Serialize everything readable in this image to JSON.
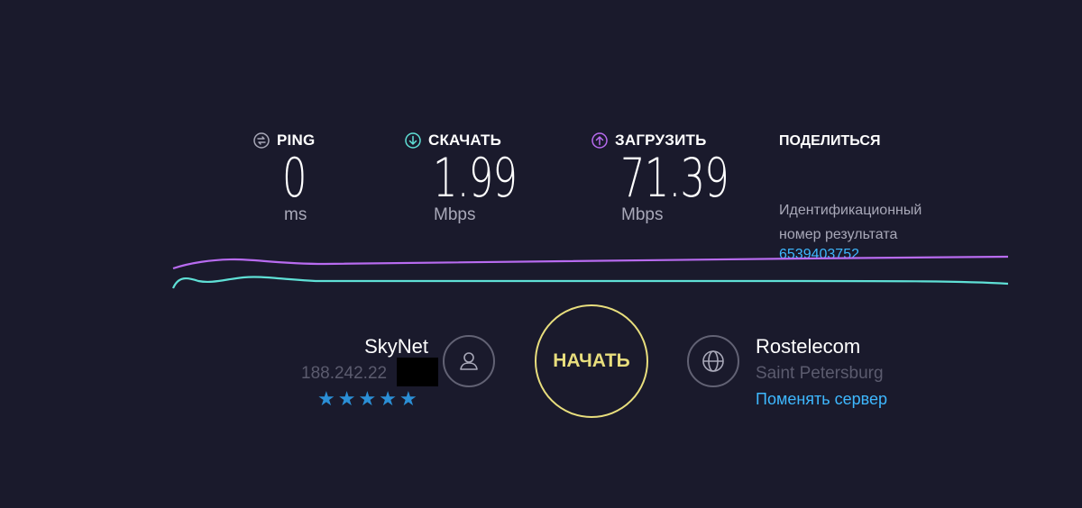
{
  "metrics": {
    "ping": {
      "label": "PING",
      "value": "0",
      "unit": "ms",
      "icon": "ping-icon",
      "color": "#a8a8b8"
    },
    "download": {
      "label": "СКАЧАТЬ",
      "value": "1.99",
      "unit": "Mbps",
      "icon": "download-arrow-icon",
      "color": "#5fe0d6"
    },
    "upload": {
      "label": "ЗАГРУЗИТЬ",
      "value": "71.39",
      "unit": "Mbps",
      "icon": "upload-arrow-icon",
      "color": "#b86bf0"
    }
  },
  "share": {
    "title": "ПОДЕЛИТЬСЯ",
    "result_id_label": "Идентификационный номер результата",
    "result_id": "6539403752"
  },
  "graph": {
    "download_color": "#5fe0d6",
    "upload_color": "#b86bf0"
  },
  "isp": {
    "name": "SkyNet",
    "ip": "188.242.22",
    "rating_stars": 5,
    "stars": [
      "★",
      "★",
      "★",
      "★",
      "★"
    ],
    "icon": "user-icon"
  },
  "start_button": {
    "label": "НАЧАТЬ",
    "color": "#e8de7d"
  },
  "server": {
    "name": "Rostelecom",
    "city": "Saint Petersburg",
    "change_label": "Поменять сервер",
    "icon": "globe-icon"
  },
  "colors": {
    "background": "#1a1a2c",
    "link": "#3eb8ff"
  }
}
